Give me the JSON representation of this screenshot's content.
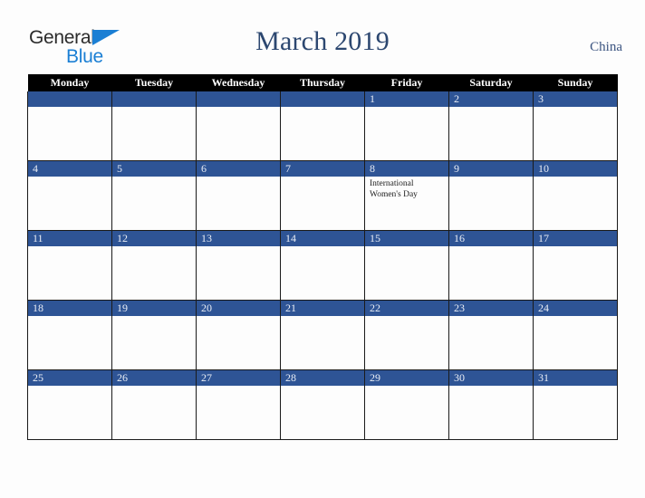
{
  "brand": {
    "word_one": "General",
    "word_two": "Blue",
    "triangle_color": "#1b7fd4"
  },
  "header": {
    "title": "March 2019",
    "country": "China",
    "title_color": "#2c4770"
  },
  "calendar": {
    "weekday_headers": [
      "Monday",
      "Tuesday",
      "Wednesday",
      "Thursday",
      "Friday",
      "Saturday",
      "Sunday"
    ],
    "header_bg": "#000000",
    "day_band_bg": "#2e5495",
    "weeks": [
      [
        {
          "day": "",
          "events": []
        },
        {
          "day": "",
          "events": []
        },
        {
          "day": "",
          "events": []
        },
        {
          "day": "",
          "events": []
        },
        {
          "day": "1",
          "events": []
        },
        {
          "day": "2",
          "events": []
        },
        {
          "day": "3",
          "events": []
        }
      ],
      [
        {
          "day": "4",
          "events": []
        },
        {
          "day": "5",
          "events": []
        },
        {
          "day": "6",
          "events": []
        },
        {
          "day": "7",
          "events": []
        },
        {
          "day": "8",
          "events": [
            "International Women's Day"
          ]
        },
        {
          "day": "9",
          "events": []
        },
        {
          "day": "10",
          "events": []
        }
      ],
      [
        {
          "day": "11",
          "events": []
        },
        {
          "day": "12",
          "events": []
        },
        {
          "day": "13",
          "events": []
        },
        {
          "day": "14",
          "events": []
        },
        {
          "day": "15",
          "events": []
        },
        {
          "day": "16",
          "events": []
        },
        {
          "day": "17",
          "events": []
        }
      ],
      [
        {
          "day": "18",
          "events": []
        },
        {
          "day": "19",
          "events": []
        },
        {
          "day": "20",
          "events": []
        },
        {
          "day": "21",
          "events": []
        },
        {
          "day": "22",
          "events": []
        },
        {
          "day": "23",
          "events": []
        },
        {
          "day": "24",
          "events": []
        }
      ],
      [
        {
          "day": "25",
          "events": []
        },
        {
          "day": "26",
          "events": []
        },
        {
          "day": "27",
          "events": []
        },
        {
          "day": "28",
          "events": []
        },
        {
          "day": "29",
          "events": []
        },
        {
          "day": "30",
          "events": []
        },
        {
          "day": "31",
          "events": []
        }
      ]
    ]
  }
}
